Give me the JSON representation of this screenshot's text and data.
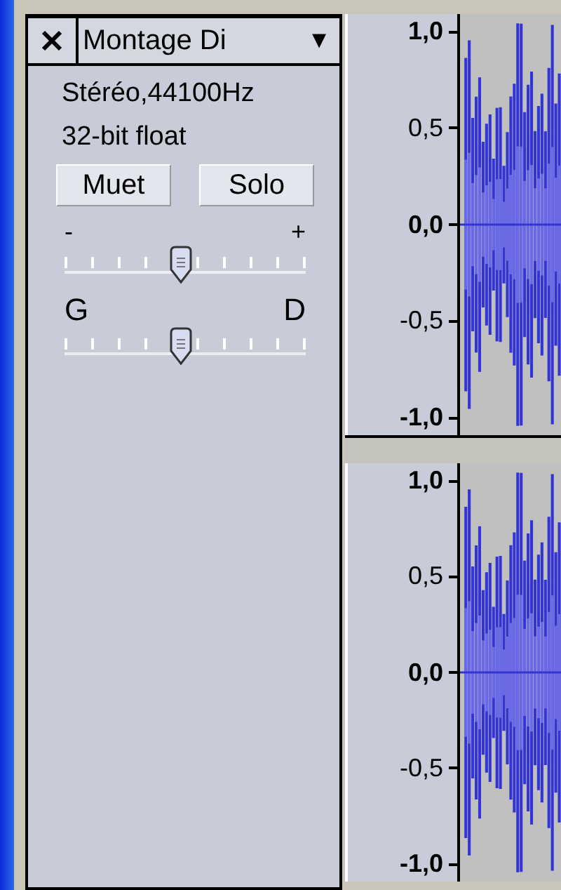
{
  "track": {
    "title": "Montage Di",
    "menu_arrow": "▼",
    "info": [
      "Stéréo,44100Hz",
      "32-bit float"
    ],
    "buttons": [
      "Muet",
      "Solo"
    ],
    "sliders": [
      {
        "kind": "gain",
        "min_label": "-",
        "max_label": "+",
        "level": 0.48
      },
      {
        "kind": "pan",
        "min_label": "G",
        "max_label": "D",
        "level": 0.48
      }
    ]
  },
  "channels": [
    {
      "ruler_labels": [
        {
          "text": "1,0",
          "major": true
        },
        {
          "text": "0,5",
          "major": false
        },
        {
          "text": "0,0",
          "major": true
        },
        {
          "text": "-0,5",
          "major": false
        },
        {
          "text": "-1,0",
          "major": true
        }
      ]
    },
    {
      "ruler_labels": [
        {
          "text": "1,0",
          "major": true
        },
        {
          "text": "0,5",
          "major": false
        },
        {
          "text": "0,0",
          "major": true
        },
        {
          "text": "-0,5",
          "major": false
        },
        {
          "text": "-1,0",
          "major": true
        }
      ]
    }
  ]
}
